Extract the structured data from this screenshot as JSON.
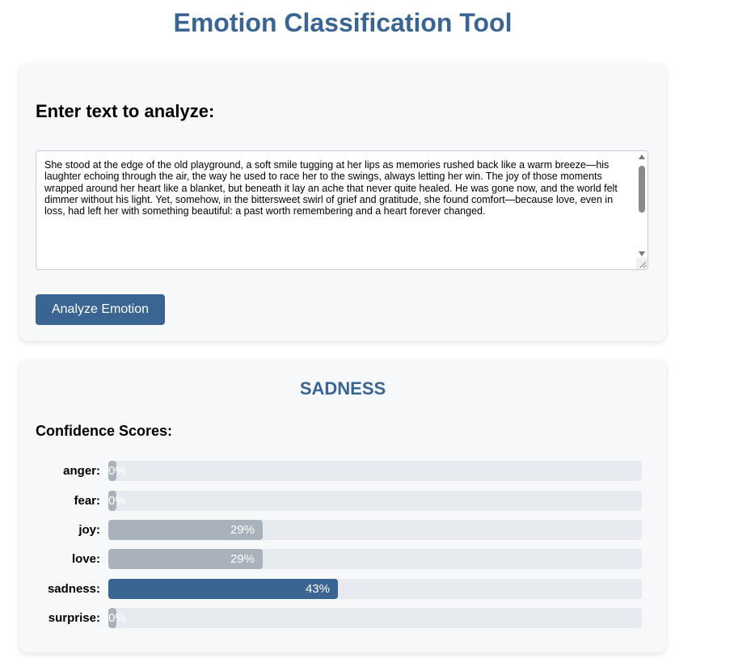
{
  "app": {
    "title": "Emotion Classification Tool"
  },
  "input": {
    "heading": "Enter text to analyze:",
    "text": "She stood at the edge of the old playground, a soft smile tugging at her lips as memories rushed back like a warm breeze—his laughter echoing through the air, the way he used to race her to the swings, always letting her win. The joy of those moments wrapped around her heart like a blanket, but beneath it lay an ache that never quite healed. He was gone now, and the world felt dimmer without his light. Yet, somehow, in the bittersweet swirl of grief and gratitude, she found comfort—because love, even in loss, had left her with something beautiful: a past worth remembering and a heart forever changed.",
    "button_label": "Analyze Emotion"
  },
  "result": {
    "label": "SADNESS",
    "scores_heading": "Confidence Scores:",
    "scores": [
      {
        "emotion": "anger:",
        "percent": 0,
        "display": "0%",
        "highlight": false
      },
      {
        "emotion": "fear:",
        "percent": 0,
        "display": "0%",
        "highlight": false
      },
      {
        "emotion": "joy:",
        "percent": 29,
        "display": "29%",
        "highlight": false
      },
      {
        "emotion": "love:",
        "percent": 29,
        "display": "29%",
        "highlight": false
      },
      {
        "emotion": "sadness:",
        "percent": 43,
        "display": "43%",
        "highlight": true
      },
      {
        "emotion": "surprise:",
        "percent": 0,
        "display": "0%",
        "highlight": false
      }
    ]
  },
  "colors": {
    "accent": "#3a6592",
    "bar_track": "#e7eaee",
    "bar_fill": "#a9b1ba",
    "card_background": "#f7f8fa"
  }
}
